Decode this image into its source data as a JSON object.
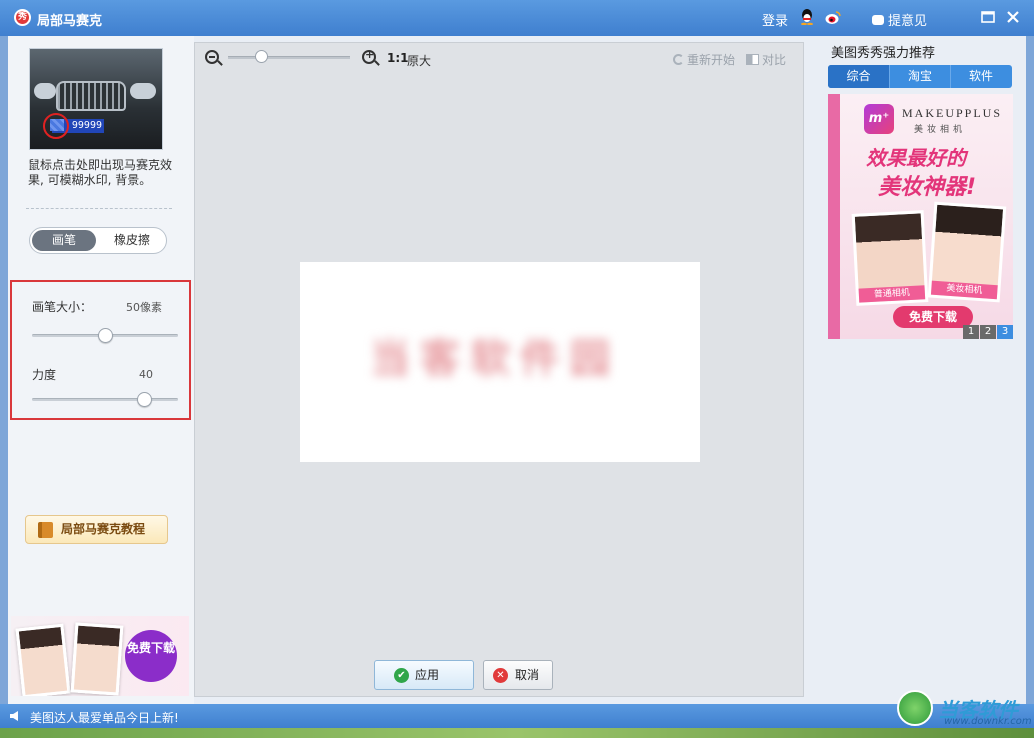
{
  "window": {
    "app_icon_char": "秀",
    "title": "局部马赛克",
    "login": "登录",
    "feedback": "提意见"
  },
  "left_panel": {
    "preview_plate_text": "99999",
    "hint": "鼠标点击处即出现马赛克效果, 可模糊水印, 背景。",
    "mode_toggle": {
      "brush": "画笔",
      "eraser": "橡皮擦",
      "active": "brush"
    },
    "brush_size": {
      "label": "画笔大小：",
      "value": "50像素",
      "fraction": 0.5
    },
    "strength": {
      "label": "力度",
      "value": "40",
      "fraction": 0.8
    },
    "tutorial_button": "局部马赛克教程",
    "ad_download": "免费下载"
  },
  "canvas": {
    "zoom_fraction": 0.25,
    "ratio_label": "1:1",
    "original_label": "原大",
    "restart": "重新开始",
    "compare": "对比",
    "blurred_text": "当客软件园",
    "apply": "应用",
    "cancel": "取消"
  },
  "right_panel": {
    "title": "美图秀秀强力推荐",
    "tabs": [
      "综合",
      "淘宝",
      "软件"
    ],
    "active_tab": 0,
    "ad": {
      "logo": "m⁺",
      "brand": "MAKEUPPLUS",
      "brand_sub": "美妆相机",
      "slogan_line1": "效果最好的",
      "slogan_line2": "美妆神器!",
      "photo1_label": "普通相机",
      "photo2_label": "美妆相机",
      "download": "免费下载"
    },
    "pager": [
      "1",
      "2",
      "3"
    ],
    "active_page": 2
  },
  "statusbar": {
    "message": "美图达人最爱单品今日上新!",
    "watermark": "当客软件园",
    "watermark_url": "www.downkr.com"
  }
}
